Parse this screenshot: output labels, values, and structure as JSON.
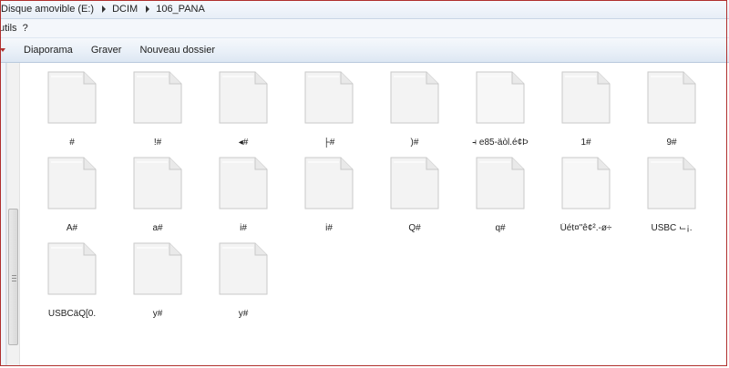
{
  "address_bar": {
    "crumbs": [
      "Disque amovible (E:)",
      "DCIM",
      "106_PANA"
    ],
    "separator_icon": "chevron-right-icon"
  },
  "menu": {
    "items": [
      "utils",
      "?"
    ]
  },
  "toolbar": {
    "buttons": [
      "Diaporama",
      "Graver",
      "Nouveau dossier"
    ]
  },
  "files": {
    "icon": "blank-document-icon",
    "rows": [
      [
        "#",
        "!#",
        "◂#",
        "├#",
        ")#",
        "⫞ e85-äòl.é¢Þ",
        "1#",
        "9#"
      ],
      [
        "A#",
        "a#",
        "i#",
        "i#",
        "Q#",
        "q#",
        "Üét¤\"ê¢².-ø÷",
        "USBC ⌙¡."
      ],
      [
        "USBCäQ[0.",
        "y#",
        "y#"
      ]
    ]
  },
  "colors": {
    "window_border": "#b0302e",
    "toolbar_top": "#f5f8fc",
    "toolbar_bottom": "#dde7f3"
  }
}
